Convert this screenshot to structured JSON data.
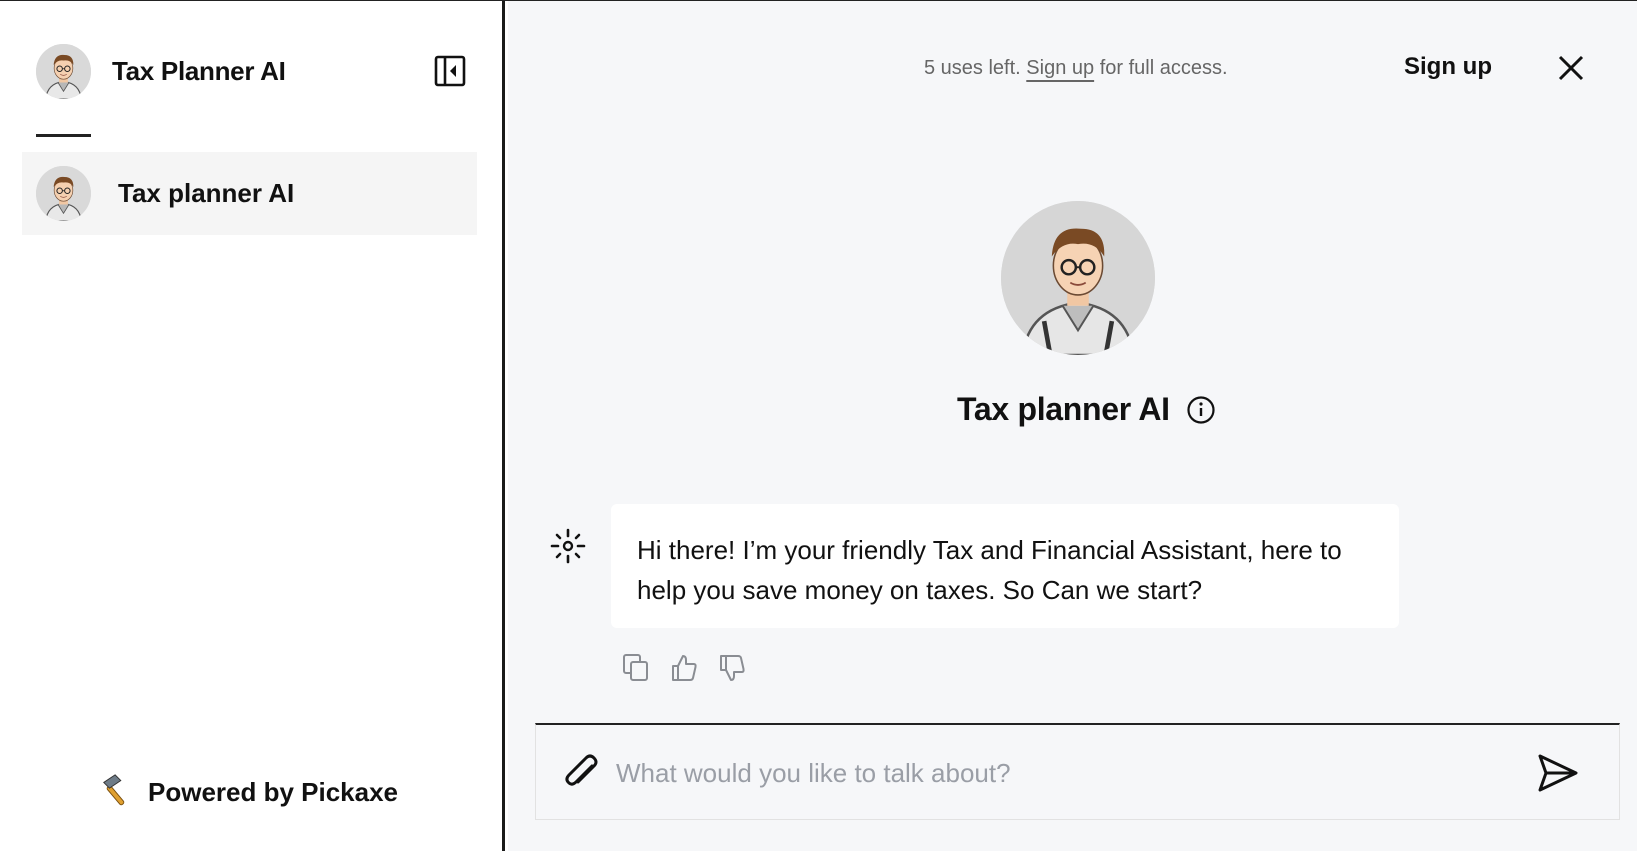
{
  "sidebar": {
    "title": "Tax Planner AI",
    "items": [
      {
        "label": "Tax planner AI"
      }
    ],
    "footer_label": "Powered by Pickaxe",
    "footer_icon": "hammer-icon"
  },
  "topbar": {
    "uses_left": "5 uses left.",
    "signup_link": "Sign up",
    "note_suffix": "for full access.",
    "signup_button": "Sign up"
  },
  "bot": {
    "name": "Tax planner AI"
  },
  "messages": [
    {
      "role": "assistant",
      "text": "Hi there! I’m your friendly Tax and Financial Assistant, here to help you save money on taxes. So Can we start?"
    }
  ],
  "composer": {
    "placeholder": "What would you like to talk about?",
    "value": ""
  },
  "icons": {
    "collapse": "sidebar-collapse-icon",
    "close": "close-icon",
    "info": "info-icon",
    "assistant": "sparkle-icon",
    "copy": "copy-icon",
    "like": "thumbs-up-icon",
    "dislike": "thumbs-down-icon",
    "attach": "paperclip-icon",
    "send": "send-icon"
  },
  "colors": {
    "main_bg": "#f6f7f9",
    "item_bg": "#f5f5f5",
    "placeholder": "#9a9ea6"
  }
}
